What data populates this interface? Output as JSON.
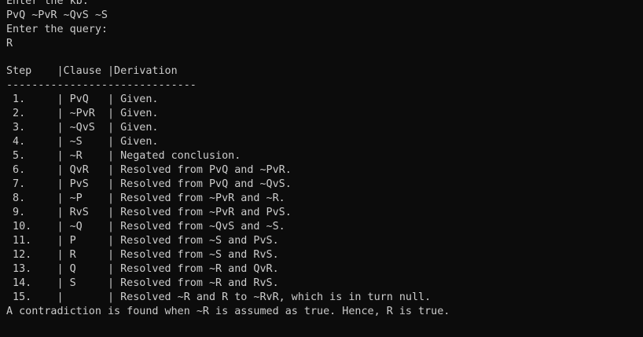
{
  "terminal": {
    "colors": {
      "background": "#0c0c0c",
      "foreground": "#cccccc"
    },
    "prompt_kb": "Enter the kb:",
    "kb_input": "PvQ ~PvR ~QvS ~S",
    "prompt_query": "Enter the query:",
    "query_input": "R",
    "table_header": "Step    |Clause |Derivation",
    "table_separator": "------------------------------",
    "rows": [
      {
        "step": " 1.",
        "clause": "PvQ",
        "derivation": "Given."
      },
      {
        "step": " 2.",
        "clause": "~PvR",
        "derivation": "Given."
      },
      {
        "step": " 3.",
        "clause": "~QvS",
        "derivation": "Given."
      },
      {
        "step": " 4.",
        "clause": "~S",
        "derivation": "Given."
      },
      {
        "step": " 5.",
        "clause": "~R",
        "derivation": "Negated conclusion."
      },
      {
        "step": " 6.",
        "clause": "QvR",
        "derivation": "Resolved from PvQ and ~PvR."
      },
      {
        "step": " 7.",
        "clause": "PvS",
        "derivation": "Resolved from PvQ and ~QvS."
      },
      {
        "step": " 8.",
        "clause": "~P",
        "derivation": "Resolved from ~PvR and ~R."
      },
      {
        "step": " 9.",
        "clause": "RvS",
        "derivation": "Resolved from ~PvR and PvS."
      },
      {
        "step": " 10.",
        "clause": "~Q",
        "derivation": "Resolved from ~QvS and ~S."
      },
      {
        "step": " 11.",
        "clause": "P",
        "derivation": "Resolved from ~S and PvS."
      },
      {
        "step": " 12.",
        "clause": "R",
        "derivation": "Resolved from ~S and RvS."
      },
      {
        "step": " 13.",
        "clause": "Q",
        "derivation": "Resolved from ~R and QvR."
      },
      {
        "step": " 14.",
        "clause": "S",
        "derivation": "Resolved from ~R and RvS."
      },
      {
        "step": " 15.",
        "clause": "",
        "derivation": "Resolved ~R and R to ~RvR, which is in turn null."
      }
    ],
    "conclusion": "A contradiction is found when ~R is assumed as true. Hence, R is true."
  }
}
